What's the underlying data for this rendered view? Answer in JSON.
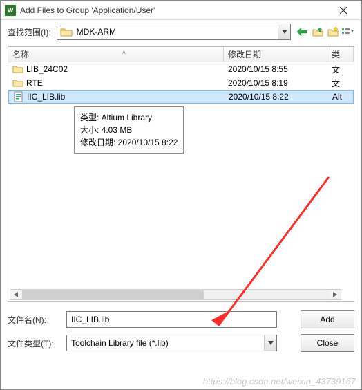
{
  "titlebar": {
    "title": "Add Files to Group 'Application/User'"
  },
  "toolbar": {
    "lookin_label": "查找范围(I):",
    "lookin_value": "MDK-ARM"
  },
  "columns": {
    "name": "名称",
    "date": "修改日期",
    "type": "类"
  },
  "sort_indicator": "^",
  "files": [
    {
      "name": "LIB_24C02",
      "date": "2020/10/15 8:55",
      "type": "文",
      "kind": "folder",
      "selected": false
    },
    {
      "name": "RTE",
      "date": "2020/10/15 8:19",
      "type": "文",
      "kind": "folder",
      "selected": false
    },
    {
      "name": "IIC_LIB.lib",
      "date": "2020/10/15 8:22",
      "type": "Alt",
      "kind": "file",
      "selected": true
    }
  ],
  "tooltip": {
    "line1": "类型: Altium Library",
    "line2": "大小: 4.03 MB",
    "line3": "修改日期: 2020/10/15 8:22"
  },
  "form": {
    "filename_label": "文件名(N):",
    "filename_value": "IIC_LIB.lib",
    "filetype_label": "文件类型(T):",
    "filetype_value": "Toolchain Library file (*.lib)",
    "add_label": "Add",
    "close_label": "Close"
  },
  "watermark": "https://blog.csdn.net/weixin_43739167",
  "colors": {
    "selection": "#cde8ff",
    "arrow": "#ff2a2a"
  }
}
